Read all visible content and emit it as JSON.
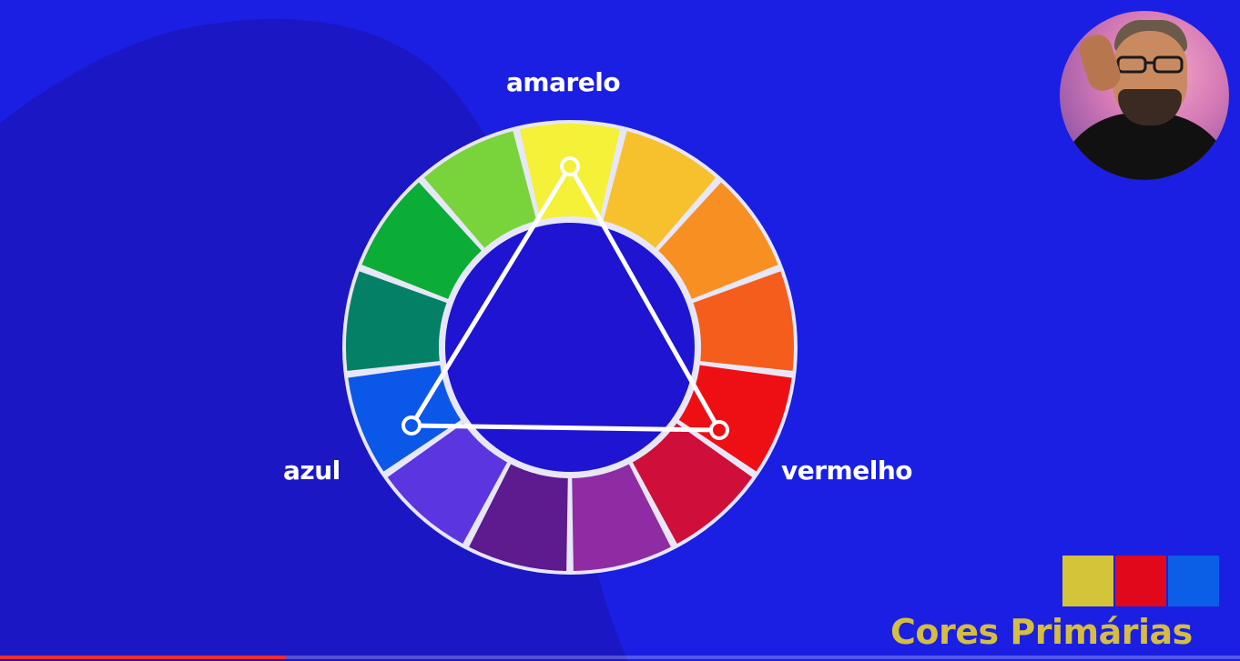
{
  "labels": {
    "amarelo": "amarelo",
    "azul": "azul",
    "vermelho": "vermelho"
  },
  "caption": "Cores Primárias",
  "wheel": {
    "segment_colors": [
      "#f5f038",
      "#f7c12e",
      "#f88f22",
      "#f45d1b",
      "#ee0f15",
      "#cf0e3a",
      "#8f2ca4",
      "#5e1a8f",
      "#5a35e0",
      "#0b57e8",
      "#038066",
      "#0cad37",
      "#79d43c"
    ],
    "gap_color": "#e7e7f7",
    "triangle_color": "#ffffff",
    "primary_points": [
      "amarelo",
      "vermelho",
      "azul"
    ]
  },
  "swatches": [
    {
      "name": "amarelo",
      "color": "#d4c43a"
    },
    {
      "name": "vermelho",
      "color": "#e1081b"
    },
    {
      "name": "azul",
      "color": "#0b5fe6"
    }
  ],
  "colors": {
    "background": "#1a1fe3",
    "background_shape": "#1c17c4",
    "caption": "#d4bd42",
    "label": "#ffffff"
  },
  "video": {
    "progress_fraction": 0.23
  },
  "icons": {
    "presenter": "presenter-avatar"
  }
}
